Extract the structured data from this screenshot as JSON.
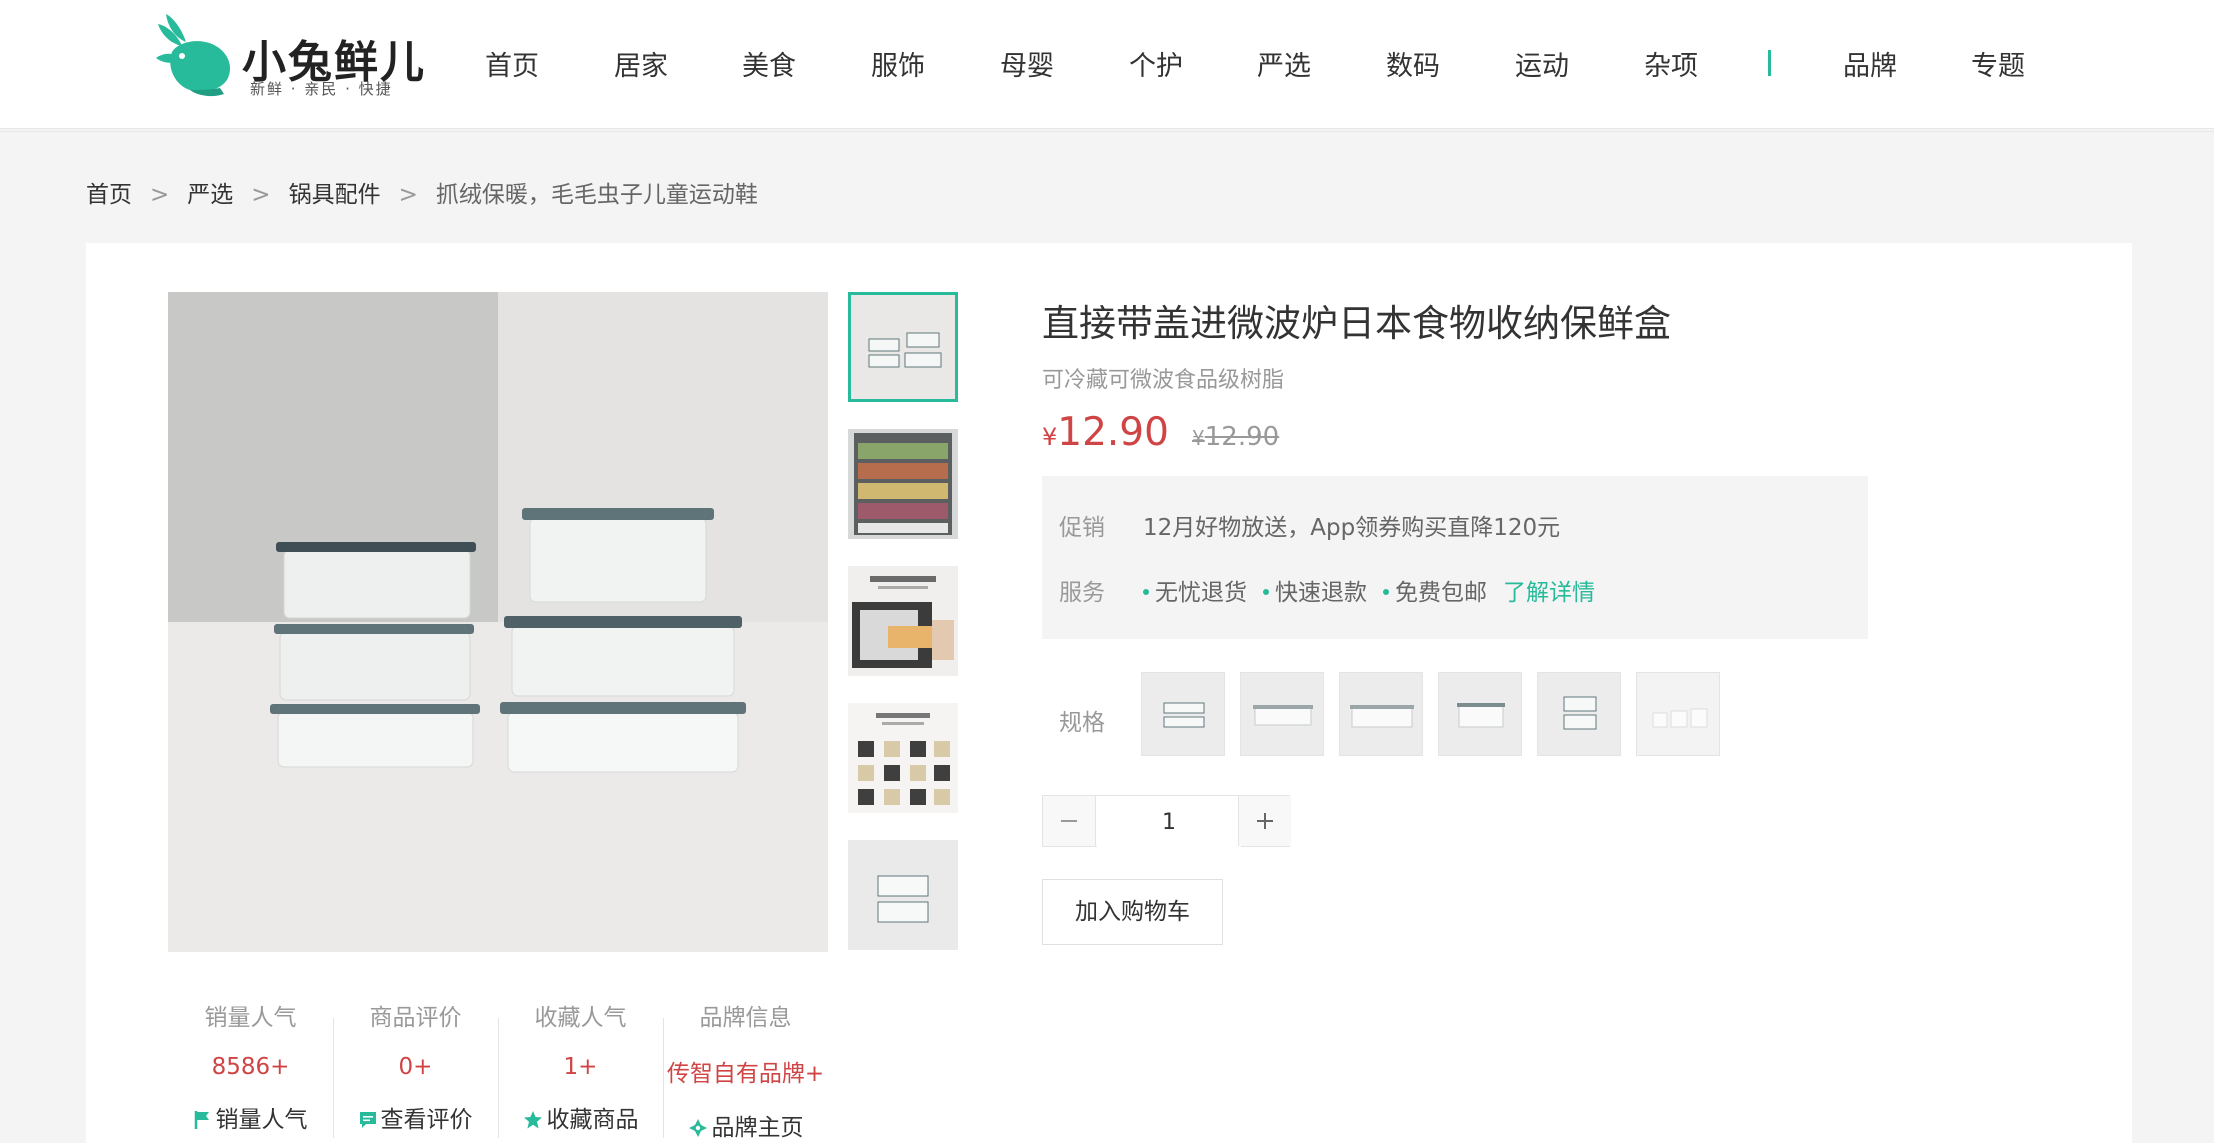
{
  "brand": {
    "name": "小兔鲜儿",
    "slogan": "新鲜 · 亲民 · 快捷",
    "accent": "#27ba9b",
    "price_color": "#cf4444"
  },
  "nav": [
    "首页",
    "居家",
    "美食",
    "服饰",
    "母婴",
    "个护",
    "严选",
    "数码",
    "运动",
    "杂项",
    "品牌",
    "专题"
  ],
  "breadcrumb": {
    "items": [
      "首页",
      "严选",
      "锅具配件"
    ],
    "current": "抓绒保暖，毛毛虫子儿童运动鞋",
    "separator": ">"
  },
  "product": {
    "title": "直接带盖进微波炉日本食物收纳保鲜盒",
    "desc": "可冷藏可微波食品级树脂",
    "currency": "¥",
    "price": "12.90",
    "old_price": "12.90"
  },
  "promo": {
    "label": "促销",
    "text": "12月好物放送，App领券购买直降120元",
    "service_label": "服务",
    "services": [
      "无忧退货",
      "快速退款",
      "免费包邮"
    ],
    "learn_more": "了解详情"
  },
  "spec": {
    "label": "规格",
    "option_count": 6
  },
  "quantity": {
    "value": "1",
    "minus_icon": "minus-icon",
    "plus_icon": "plus-icon"
  },
  "cart_button": "加入购物车",
  "stats": [
    {
      "label": "销量人气",
      "value": "8586+",
      "link": "销量人气",
      "icon": "flag-icon"
    },
    {
      "label": "商品评价",
      "value": "0+",
      "link": "查看评价",
      "icon": "comment-icon"
    },
    {
      "label": "收藏人气",
      "value": "1+",
      "link": "收藏商品",
      "icon": "star-icon"
    },
    {
      "label": "品牌信息",
      "value": "传智自有品牌+",
      "link": "品牌主页",
      "icon": "brand-icon"
    }
  ]
}
